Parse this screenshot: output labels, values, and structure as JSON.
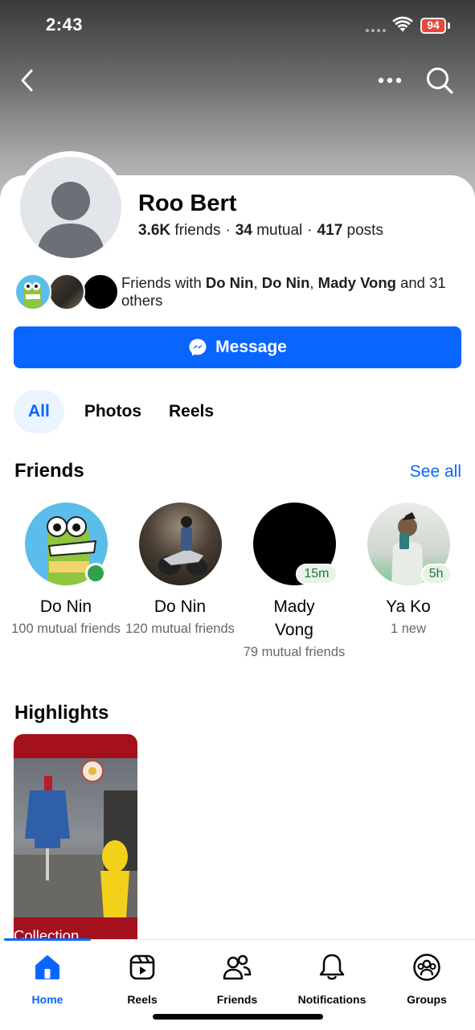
{
  "status_bar": {
    "time": "2:43",
    "battery": "94"
  },
  "top_nav": {
    "back_icon": "chevron-left-icon",
    "more_icon": "more-horizontal-icon",
    "search_icon": "search-icon"
  },
  "profile": {
    "name": "Roo Bert",
    "friends_count": "3.6K",
    "friends_label": "friends",
    "mutual_count": "34",
    "mutual_label": "mutual",
    "posts_count": "417",
    "posts_label": "posts"
  },
  "mutual_friends": {
    "prefix": "Friends with",
    "names": [
      "Do Nin",
      "Do Nin",
      "Mady Vong"
    ],
    "suffix": "and 31 others"
  },
  "message_button": {
    "label": "Message",
    "icon": "messenger-icon"
  },
  "tabs": [
    {
      "label": "All",
      "active": true
    },
    {
      "label": "Photos"
    },
    {
      "label": "Reels"
    }
  ],
  "friends_section": {
    "title": "Friends",
    "see_all": "See all",
    "items": [
      {
        "name": "Do Nin",
        "subtitle": "100 mutual friends",
        "online": true
      },
      {
        "name": "Do Nin",
        "subtitle": "120 mutual friends"
      },
      {
        "name": "Mady Vong",
        "subtitle": "79 mutual friends",
        "badge": "15m"
      },
      {
        "name": "Ya Ko",
        "subtitle": "1 new",
        "badge": "5h"
      }
    ]
  },
  "highlights_section": {
    "title": "Highlights",
    "items": [
      {
        "label": "Collection"
      }
    ]
  },
  "bottom_nav": [
    {
      "label": "Home",
      "icon": "home-icon",
      "active": true
    },
    {
      "label": "Reels",
      "icon": "reels-icon"
    },
    {
      "label": "Friends",
      "icon": "friends-icon"
    },
    {
      "label": "Notifications",
      "icon": "bell-icon"
    },
    {
      "label": "Groups",
      "icon": "groups-icon"
    }
  ],
  "colors": {
    "accent": "#0866ff",
    "online": "#31a24c",
    "highlight_bg": "#a4101c"
  }
}
